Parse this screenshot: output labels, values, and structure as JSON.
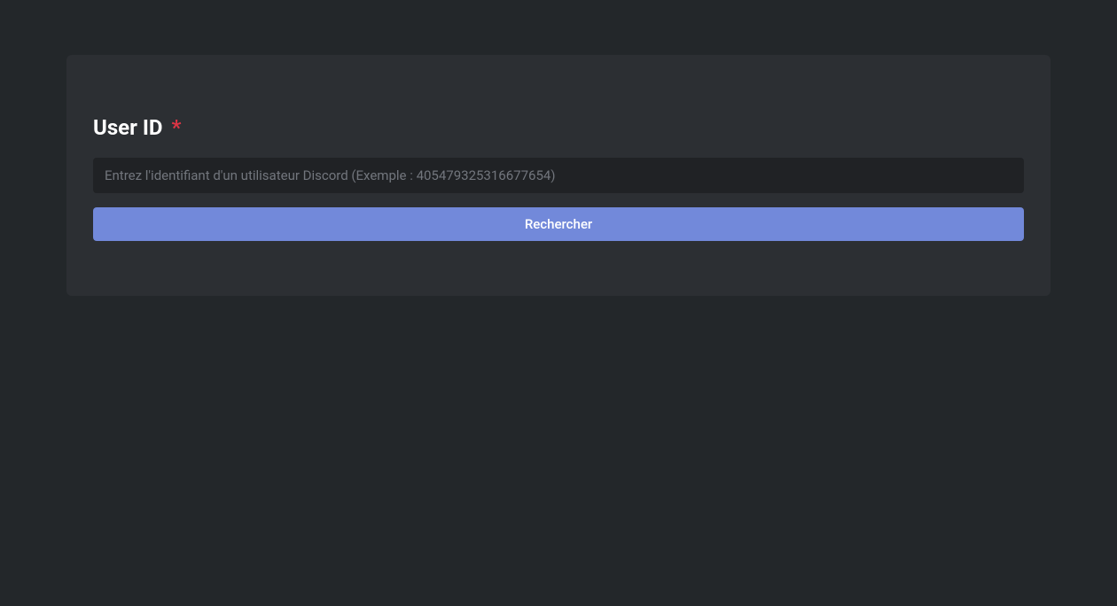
{
  "form": {
    "label": "User ID",
    "required_marker": "*",
    "input": {
      "value": "",
      "placeholder": "Entrez l'identifiant d'un utilisateur Discord (Exemple : 405479325316677654)"
    },
    "submit_label": "Rechercher"
  },
  "colors": {
    "background": "#23272a",
    "card_background": "#2c2f33",
    "input_background": "#202225",
    "button_background": "#7289da",
    "text": "#ffffff",
    "placeholder": "#72767d",
    "required": "#dc3545"
  }
}
